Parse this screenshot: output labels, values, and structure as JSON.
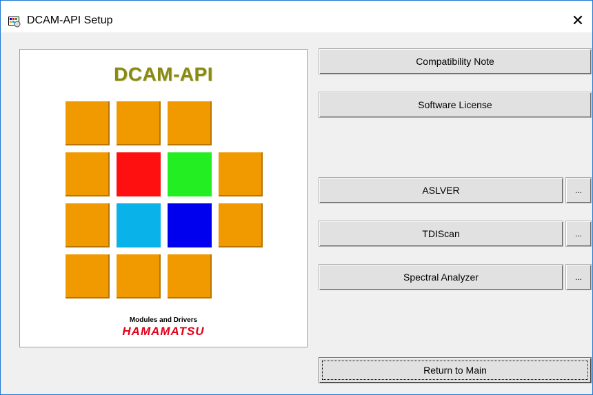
{
  "window": {
    "title": "DCAM-API Setup",
    "close_glyph": "✕"
  },
  "logo": {
    "title": "DCAM-API",
    "subtitle": "Modules and Drivers",
    "brand": "HAMAMATSU",
    "tiles": [
      "orange",
      "orange",
      "orange",
      "orange",
      "red",
      "green",
      "orange",
      "orange",
      "cyan",
      "blue",
      "orange",
      "orange",
      "orange",
      "orange"
    ]
  },
  "buttons": {
    "compatibility": "Compatibility Note",
    "license": "Software License",
    "aslver": "ASLVER",
    "tdiscan": "TDIScan",
    "spectral": "Spectral Analyzer",
    "more": "...",
    "return": "Return to Main"
  },
  "colors": {
    "accent_border": "#1e78d2",
    "brand_red": "#e2001a",
    "logo_title": "#8a8a10"
  }
}
